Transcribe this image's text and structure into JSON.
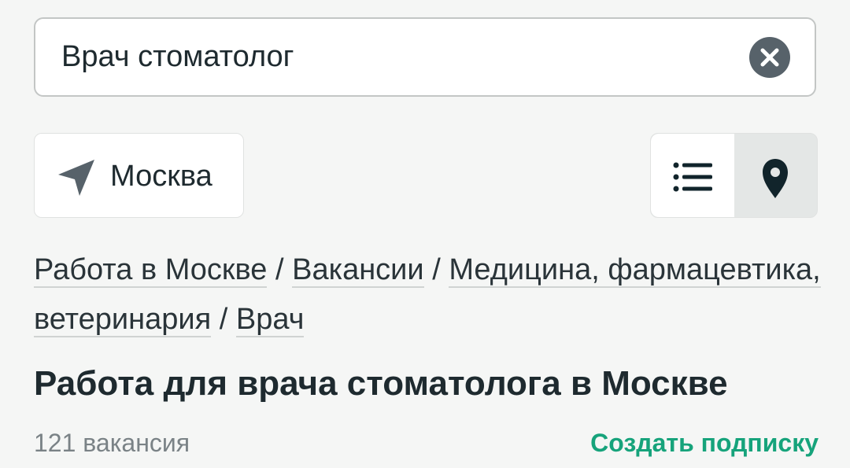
{
  "search": {
    "value": "Врач стоматолог",
    "clear_icon": "close-icon"
  },
  "location": {
    "city": "Москва",
    "icon": "navigation-arrow-icon"
  },
  "view_toggle": {
    "list_icon": "list-icon",
    "map_icon": "map-pin-icon",
    "active": "map"
  },
  "breadcrumb": {
    "items": [
      "Работа в Москве",
      "Вакансии",
      "Медицина, фармацевтика, ветеринария",
      "Врач"
    ],
    "separator": "/"
  },
  "page": {
    "title": "Работа для врача стоматолога в Москве",
    "vacancy_count": "121 вакансия",
    "subscribe_label": "Создать подписку"
  },
  "colors": {
    "accent": "#16a37b",
    "icon_dark": "#57626a",
    "text_dark": "#1e2a2f",
    "muted": "#7a8286"
  }
}
